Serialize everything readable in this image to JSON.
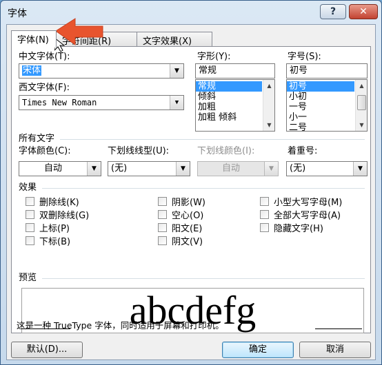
{
  "window": {
    "title": "字体",
    "help_label": "?",
    "close_label": "✕"
  },
  "tabs": [
    {
      "label": "字体(N)",
      "active": true
    },
    {
      "label": "字符间距(R)",
      "active": false
    },
    {
      "label": "文字效果(X)",
      "active": false
    }
  ],
  "font": {
    "chinese_label": "中文字体(T):",
    "chinese_value": "宋体",
    "western_label": "西文字体(F):",
    "western_value": "Times New Roman",
    "style_label": "字形(Y):",
    "style_value": "常规",
    "style_options": [
      "常规",
      "倾斜",
      "加粗",
      "加粗 倾斜"
    ],
    "size_label": "字号(S):",
    "size_value": "初号",
    "size_options": [
      "初号",
      "小初",
      "一号",
      "小一",
      "二号"
    ]
  },
  "all_text": {
    "group_label": "所有文字",
    "color_label": "字体颜色(C):",
    "color_value": "自动",
    "underline_label": "下划线线型(U):",
    "underline_value": "(无)",
    "underline_color_label": "下划线颜色(I):",
    "underline_color_value": "自动",
    "emphasis_label": "着重号:",
    "emphasis_value": "(无)"
  },
  "effects": {
    "group_label": "效果",
    "col1": [
      "删除线(K)",
      "双删除线(G)",
      "上标(P)",
      "下标(B)"
    ],
    "col2": [
      "阴影(W)",
      "空心(O)",
      "阳文(E)",
      "阴文(V)"
    ],
    "col3": [
      "小型大写字母(M)",
      "全部大写字母(A)",
      "隐藏文字(H)"
    ]
  },
  "preview": {
    "group_label": "预览",
    "sample": "abcdefg",
    "note": "这是一种 TrueType 字体，同时适用于屏幕和打印机。"
  },
  "buttons": {
    "default": "默认(D)...",
    "ok": "确定",
    "cancel": "取消"
  },
  "colors": {
    "accent": "#3399ff",
    "annotation_arrow": "#e8542e"
  }
}
